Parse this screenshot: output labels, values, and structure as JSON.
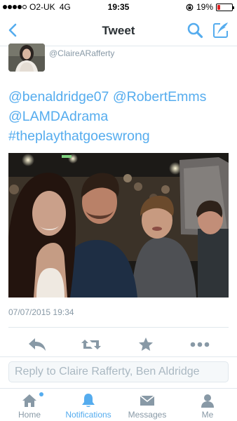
{
  "status_bar": {
    "carrier": "O2-UK",
    "network": "4G",
    "time": "19:35",
    "battery": "19%",
    "battery_level": 0.19,
    "signal_bars": 4
  },
  "nav": {
    "title": "Tweet"
  },
  "tweet": {
    "handle": "@ClaireARafferty",
    "lines": [
      "@benaldridge07 @RobertEmms",
      "@LAMDAdrama",
      "#theplaythatgoeswrong"
    ],
    "timestamp": "07/07/2015 19:34"
  },
  "reply": {
    "placeholder": "Reply to Claire Rafferty, Ben Aldridge"
  },
  "tabs": [
    {
      "label": "Home",
      "icon": "home-icon"
    },
    {
      "label": "Notifications",
      "icon": "bell-icon"
    },
    {
      "label": "Messages",
      "icon": "envelope-icon"
    },
    {
      "label": "Me",
      "icon": "person-icon"
    }
  ],
  "colors": {
    "accent": "#55acee",
    "muted": "#8899a6",
    "battery_low": "#e02020"
  }
}
